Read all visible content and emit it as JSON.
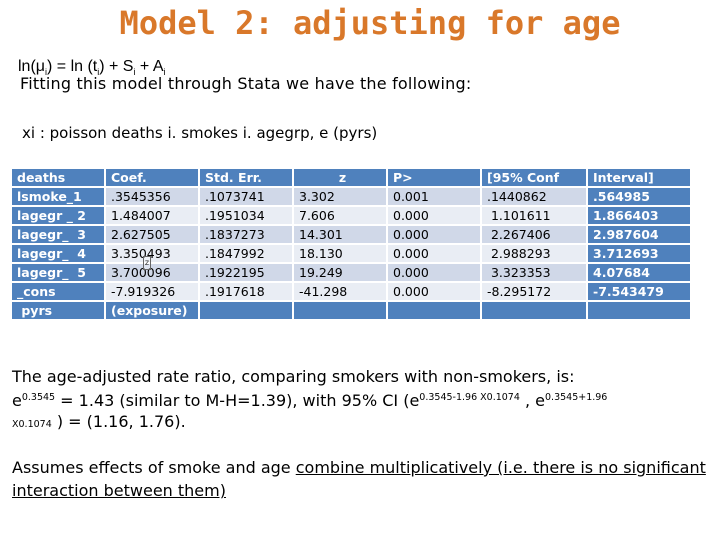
{
  "slide": {
    "title": "Model 2: adjusting for age",
    "title_color": "#d9782a",
    "formula": {
      "p1": "ln(μ",
      "s1": "i",
      "p2": ") = ln (t",
      "s2": "i",
      "p3": ") +  S",
      "s3": "i",
      "p4": " + A",
      "s4": "i"
    },
    "fitting_text": "Fitting  this model through Stata we have the following:",
    "command": "xi : poisson deaths i. smokes i. agegrp, e (pyrs)"
  },
  "table": {
    "header_color": "#4f81bd",
    "headers": [
      "deaths",
      "Coef.",
      "Std. Err.",
      "z",
      "P>",
      "[95% Conf",
      "Interval]"
    ],
    "rows": [
      {
        "label": "lsmoke_1",
        "coef": ".3545356",
        "se": ".1073741",
        "z": "3.302",
        "p": "0.001",
        "lo": ".1440862",
        "hi": ".564985"
      },
      {
        "label": "lagegr _ 2",
        "coef": "1.484007",
        "se": ".1951034",
        "z": "7.606",
        "p": "0.000",
        "lo": " 1.101611",
        "hi": "1.866403"
      },
      {
        "label": "lagegr_  3",
        "coef": "2.627505",
        "se": ".1837273",
        "z": "14.301",
        "p": "0.000",
        "lo": " 2.267406",
        "hi": "2.987604"
      },
      {
        "label": "lagegr_  4",
        "coef": "3.350493",
        "se": ".1847992",
        "z": "18.130",
        "p": "0.000",
        "lo": " 2.988293",
        "hi": "3.712693"
      },
      {
        "label": "lagegr_  5",
        "coef": "3.700096",
        "se": ".1922195",
        "z": "19.249",
        "p": "0.000",
        "lo": " 3.323353",
        "hi": "4.07684"
      },
      {
        "label": "_cons",
        "coef": "-7.919326",
        "se": ".1917618",
        "z": "-41.298",
        "p": "0.000",
        "lo": "-8.295172",
        "hi": "-7.543479"
      },
      {
        "label": " pyrs",
        "coef": "(exposure)",
        "se": "",
        "z": "",
        "p": "",
        "lo": "",
        "hi": ""
      }
    ],
    "cursor_glyph": "z"
  },
  "result": {
    "line1": "The age-adjusted rate ratio, comparing smokers with non-smokers, is:",
    "e1": "e",
    "exp1": "0.3545",
    "t1": " = 1.43  (similar to M-H=1.39),  with 95% CI (e",
    "exp2": "0.3545-1.96 X0.1074",
    "t2": "   , e",
    "exp3": "0.3545+1.96",
    "exp3b": "X0.1074",
    "t3": " ) = (1.16, 1.76)."
  },
  "assumption": {
    "plain": "Assumes effects of smoke and age ",
    "underlined": "combine multiplicatively (i.e. there is no significant interaction between them)"
  }
}
